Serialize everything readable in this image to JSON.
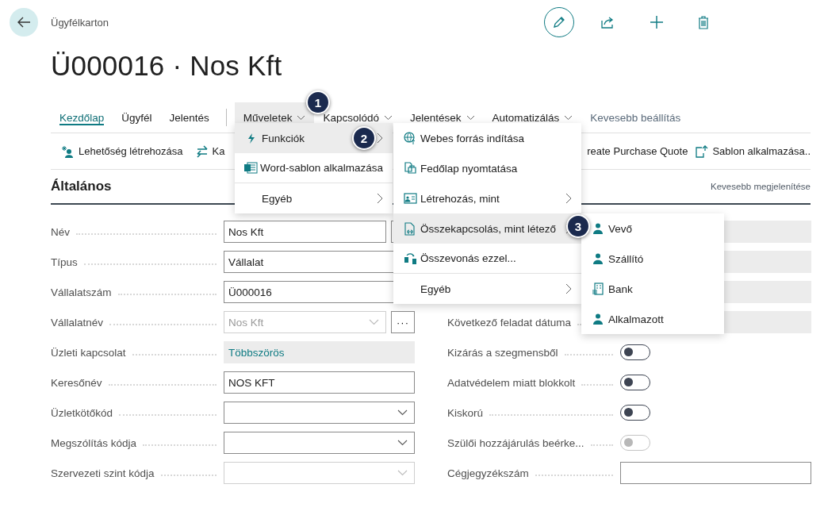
{
  "breadcrumb": "Ügyfélkarton",
  "title": "Ü000016 · Nos Kft",
  "tabs": [
    {
      "label": "Kezdőlap",
      "kind": "tab",
      "selected": true,
      "open": false
    },
    {
      "label": "Ügyfél",
      "kind": "tab",
      "selected": false,
      "open": false
    },
    {
      "label": "Jelentés",
      "kind": "tab",
      "selected": false,
      "open": false
    },
    {
      "label": "Műveletek",
      "kind": "menu",
      "selected": false,
      "open": true
    },
    {
      "label": "Kapcsolódó",
      "kind": "menu",
      "selected": false,
      "open": false
    },
    {
      "label": "Jelentések",
      "kind": "menu",
      "selected": false,
      "open": false
    },
    {
      "label": "Automatizálás",
      "kind": "menu",
      "selected": false,
      "open": false
    },
    {
      "label": "Kevesebb beállítás",
      "kind": "link",
      "selected": false,
      "open": false
    }
  ],
  "actions": [
    "Lehetőség létrehozása",
    "Ka",
    "reate Purchase Quote",
    "Sablon alkalmazása.."
  ],
  "section": {
    "title": "Általános",
    "toggle_link": "Kevesebb megjelenítése"
  },
  "left_fields": [
    {
      "label": "Név",
      "kind": "text",
      "value": "Nos Kft",
      "assist": true
    },
    {
      "label": "Típus",
      "kind": "text",
      "value": "Vállalat",
      "assist": false
    },
    {
      "label": "Vállalatszám",
      "kind": "text",
      "value": "Ü000016",
      "assist": false
    },
    {
      "label": "Vállalatnév",
      "kind": "dropdown",
      "value": "Nos Kft",
      "disabled": true,
      "assist": true,
      "assist_text": "···"
    },
    {
      "label": "Üzleti kapcsolat",
      "kind": "link",
      "value": "Többszörös",
      "assist": false
    },
    {
      "label": "Keresőnév",
      "kind": "text",
      "value": "NOS KFT",
      "assist": false
    },
    {
      "label": "Üzletkötőkód",
      "kind": "dropdown",
      "disabled": false,
      "assist": false
    },
    {
      "label": "Megszólítás kódja",
      "kind": "dropdown",
      "disabled": false,
      "assist": false
    },
    {
      "label": "Szervezeti szint kódja",
      "kind": "dropdown",
      "disabled": true,
      "assist": false
    }
  ],
  "right_fields": [
    {
      "kind": "readonly"
    },
    {
      "kind": "readonly"
    },
    {
      "kind": "readonly"
    },
    {
      "label": "Következő feladat dátuma",
      "kind": "readonly"
    },
    {
      "label": "Kizárás a szegmensből",
      "kind": "toggle",
      "on": false,
      "disabled": false
    },
    {
      "label": "Adatvédelem miatt blokkolt",
      "kind": "toggle",
      "on": false,
      "disabled": false
    },
    {
      "label": "Kiskorú",
      "kind": "toggle",
      "on": false,
      "disabled": false
    },
    {
      "label": "Szülői hozzájárulás beérke...",
      "kind": "toggle",
      "on": false,
      "disabled": true
    },
    {
      "label": "Cégjegyzékszám",
      "kind": "text"
    }
  ],
  "menus": [
    {
      "items": [
        {
          "label": "Funkciók",
          "selected": true,
          "submenu": true,
          "divider_after": false
        },
        {
          "label": "Word-sablon alkalmazása",
          "selected": false,
          "submenu": false,
          "divider_after": true
        },
        {
          "label": "Egyéb",
          "selected": false,
          "submenu": true,
          "divider_after": false
        }
      ]
    },
    {
      "items": [
        {
          "label": "Webes forrás indítása",
          "selected": false,
          "submenu": false,
          "divider_after": false
        },
        {
          "label": "Fedőlap nyomtatása",
          "selected": false,
          "submenu": false,
          "divider_after": false
        },
        {
          "label": "Létrehozás, mint",
          "selected": false,
          "submenu": true,
          "divider_after": false
        },
        {
          "label": "Összekapcsolás, mint létező",
          "selected": true,
          "submenu": true,
          "divider_after": false
        },
        {
          "label": "Összevonás ezzel...",
          "selected": false,
          "submenu": false,
          "divider_after": true
        },
        {
          "label": "Egyéb",
          "selected": false,
          "submenu": true,
          "divider_after": false
        }
      ]
    },
    {
      "items": [
        {
          "label": "Vevő",
          "selected": false,
          "submenu": false,
          "divider_after": false
        },
        {
          "label": "Szállító",
          "selected": false,
          "submenu": false,
          "divider_after": false
        },
        {
          "label": "Bank",
          "selected": false,
          "submenu": false,
          "divider_after": false
        },
        {
          "label": "Alkalmazott",
          "selected": false,
          "submenu": false,
          "divider_after": false
        }
      ]
    }
  ],
  "badges": [
    "1",
    "2",
    "3"
  ]
}
